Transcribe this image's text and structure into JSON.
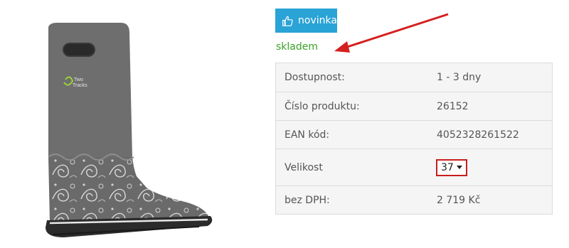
{
  "product": {
    "image_icon": "rubber-boot-image",
    "logo_text": "Two Tracks"
  },
  "badge": {
    "label": "novinka",
    "icon": "thumbs-up-icon",
    "color": "#2aa3d6"
  },
  "availability": {
    "status": "skladem",
    "color": "#3aa326"
  },
  "annotation": {
    "icon": "red-arrow",
    "color": "#d42020"
  },
  "params": {
    "delivery": {
      "label": "Dostupnost:",
      "value": "1 - 3 dny"
    },
    "product_number": {
      "label": "Číslo produktu:",
      "value": "26152"
    },
    "ean": {
      "label": "EAN kód:",
      "value": "4052328261522"
    },
    "size": {
      "label": "Velikost",
      "value": "37"
    },
    "price_excl_vat": {
      "label": "bez DPH:",
      "value": "2 719 Kč"
    }
  }
}
